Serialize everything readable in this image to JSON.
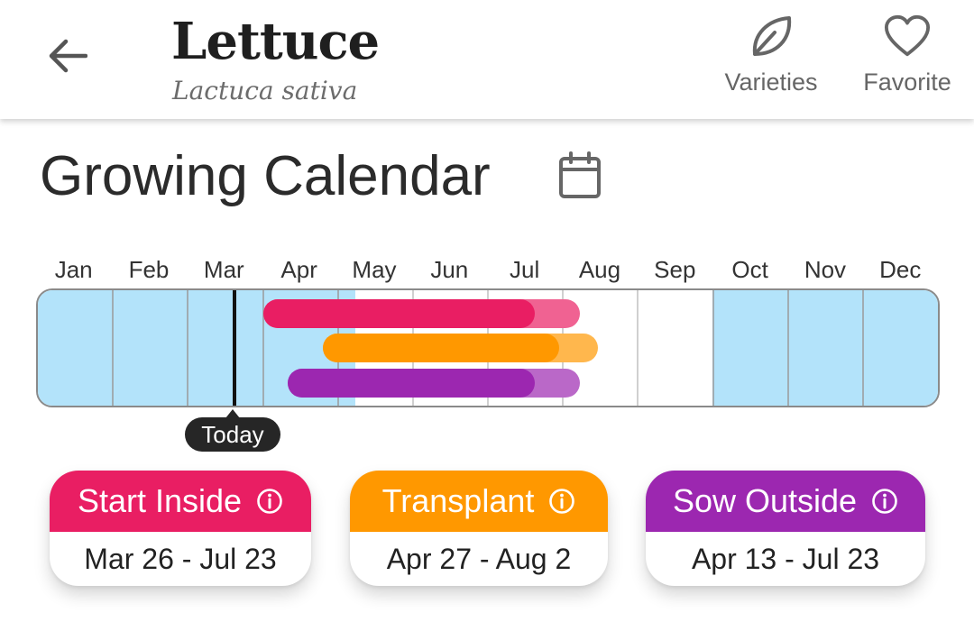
{
  "header": {
    "title": "Lettuce",
    "subtitle": "Lactuca sativa",
    "back_icon": "arrow-left-icon",
    "actions": [
      {
        "label": "Varieties",
        "icon": "leaf-icon"
      },
      {
        "label": "Favorite",
        "icon": "heart-outline-icon"
      }
    ]
  },
  "section": {
    "title": "Growing Calendar",
    "icon": "calendar-icon"
  },
  "calendar": {
    "months": [
      "Jan",
      "Feb",
      "Mar",
      "Apr",
      "May",
      "Jun",
      "Jul",
      "Aug",
      "Sep",
      "Oct",
      "Nov",
      "Dec"
    ],
    "today_label": "Today",
    "today_month_position": 2.62,
    "growing_season_color": "#b3e3fa",
    "bars": [
      {
        "name": "Start Inside",
        "color": "#e91e63",
        "light_color": "#f06292",
        "start": 3.0,
        "solid_end": 6.62,
        "end": 7.23
      },
      {
        "name": "Transplant",
        "color": "#ff9800",
        "light_color": "#ffb74d",
        "start": 3.8,
        "solid_end": 6.95,
        "end": 7.47
      },
      {
        "name": "Sow Outside",
        "color": "#9c27b0",
        "light_color": "#ba68c8",
        "start": 3.33,
        "solid_end": 6.62,
        "end": 7.23
      }
    ]
  },
  "cards": [
    {
      "title": "Start Inside",
      "dates": "Mar 26 - Jul 23",
      "color": "#e91e63",
      "icon": "info-icon"
    },
    {
      "title": "Transplant",
      "dates": "Apr 27 - Aug 2",
      "color": "#ff9800",
      "icon": "info-icon"
    },
    {
      "title": "Sow Outside",
      "dates": "Apr 13 - Jul 23",
      "color": "#9c27b0",
      "icon": "info-icon"
    }
  ]
}
